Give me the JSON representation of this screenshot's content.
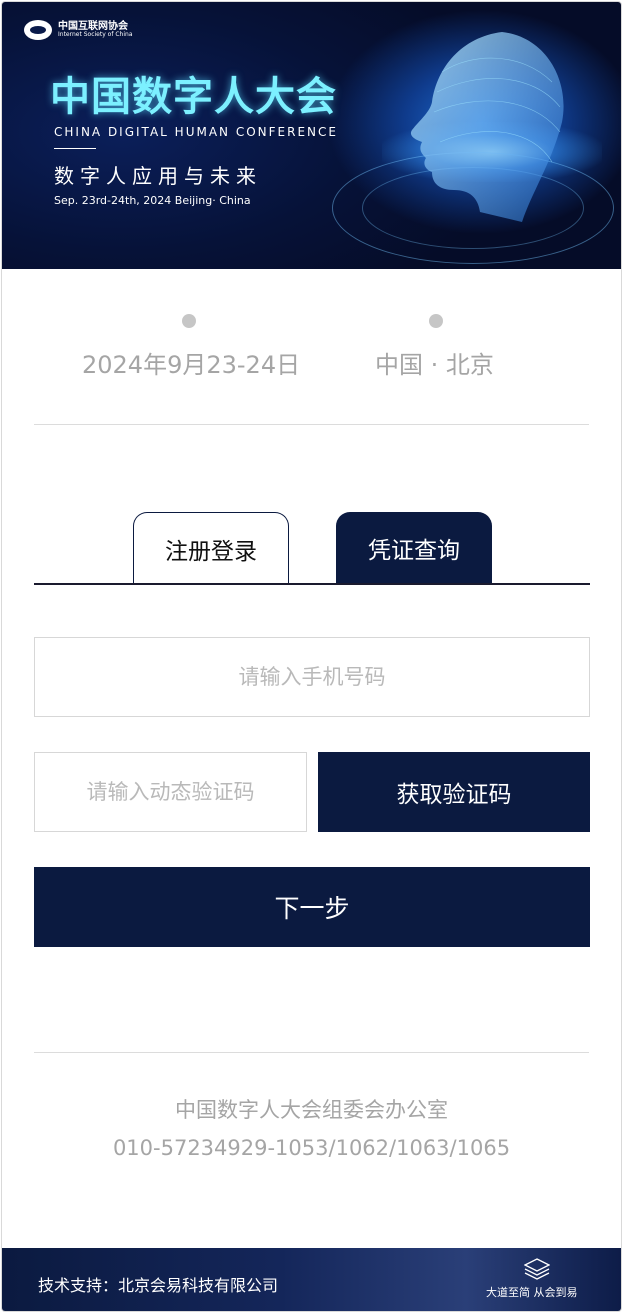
{
  "banner": {
    "org_cn": "中国互联网协会",
    "org_en": "Internet Society of China",
    "title": "中国数字人大会",
    "subtitle_en": "CHINA DIGITAL HUMAN CONFERENCE",
    "subtitle_cn": "数字人应用与未来",
    "date_location": "Sep. 23rd-24th, 2024    Beijing· China"
  },
  "event": {
    "date": "2024年9月23-24日",
    "location": "中国 · 北京"
  },
  "tabs": [
    {
      "label": "注册登录",
      "active": false
    },
    {
      "label": "凭证查询",
      "active": true
    }
  ],
  "form": {
    "phone_placeholder": "请输入手机号码",
    "code_placeholder": "请输入动态验证码",
    "get_code_label": "获取验证码",
    "next_label": "下一步"
  },
  "contact": {
    "org": "中国数字人大会组委会办公室",
    "phone": "010-57234929-1053/1062/1063/1065"
  },
  "footer": {
    "support": "技术支持：北京会易科技有限公司",
    "slogan": "大道至简 从会到易"
  },
  "colors": {
    "primary": "#0b1a40",
    "muted_text": "#a5a5a5",
    "title_cyan": "#7cf0ff"
  }
}
